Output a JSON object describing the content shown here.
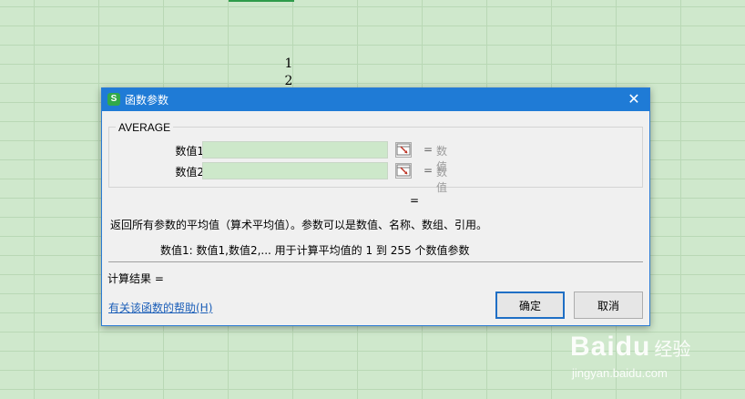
{
  "sheet": {
    "cells": [
      "1",
      "2"
    ]
  },
  "dialog": {
    "title": "函数参数",
    "app_icon": "S",
    "close_glyph": "✕",
    "function_name": "AVERAGE",
    "args": [
      {
        "label": "数值1",
        "value": "",
        "hint": "数值",
        "eq": "="
      },
      {
        "label": "数值2",
        "value": "",
        "hint": "数值",
        "eq": "="
      }
    ],
    "result_eq": "=",
    "description": "返回所有参数的平均值（算术平均值）。参数可以是数值、名称、数组、引用。",
    "param_description": "数值1:  数值1,数值2,... 用于计算平均值的 1 到 255 个数值参数",
    "calc_label": "计算结果  =",
    "help_link": "有关该函数的帮助(H)",
    "ok_label": "确定",
    "cancel_label": "取消"
  },
  "watermark": {
    "logo": "Bai",
    "paw": "du",
    "cn": "经验",
    "url": "jingyan.baidu.com"
  },
  "colors": {
    "titlebar": "#1f7bd6",
    "input_bg": "#cde8ca",
    "link": "#1c5fb8"
  }
}
